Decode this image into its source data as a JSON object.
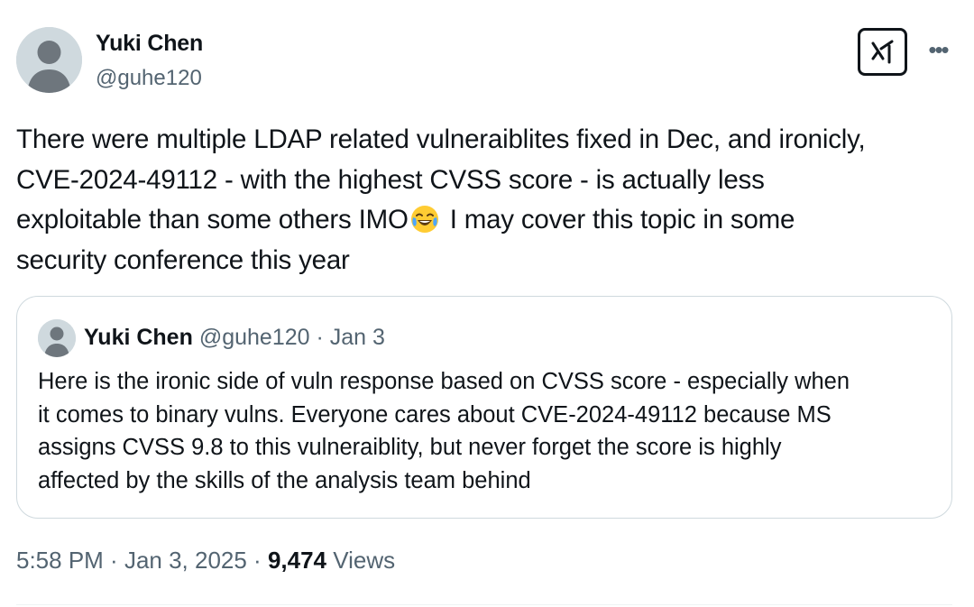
{
  "author": {
    "name": "Yuki Chen",
    "handle": "@guhe120"
  },
  "tweet": {
    "line1": "There were multiple LDAP related vulneraiblites fixed in Dec, and ironicly,",
    "line2": "CVE-2024-49112 - with the highest CVSS score - is actually less",
    "line3a": "exploitable than some others IMO",
    "emoji": "face-with-tears-of-joy",
    "line3b": " I may cover this topic in some",
    "line4": "security conference this year"
  },
  "quote": {
    "name": "Yuki Chen",
    "handle": "@guhe120",
    "separator": " · ",
    "date": "Jan 3",
    "lines": [
      "Here is the ironic side of vuln response based on CVSS score - especially when",
      "it comes to binary vulns. Everyone cares about CVE-2024-49112 because MS",
      "assigns CVSS 9.8 to this vulneraiblity, but never forget the score is highly",
      "affected by the skills of the analysis team behind"
    ]
  },
  "meta": {
    "time": "5:58 PM",
    "sep1": " · ",
    "date": "Jan 3, 2025",
    "sep2": " · ",
    "views_count": "9,474",
    "views_label": " Views"
  },
  "icons": {
    "grok": "grok-icon",
    "more": "more-options-icon"
  },
  "colors": {
    "text": "#0f1419",
    "secondary": "#536471",
    "border": "#cfd9de",
    "avatar": "#cfd9de"
  }
}
